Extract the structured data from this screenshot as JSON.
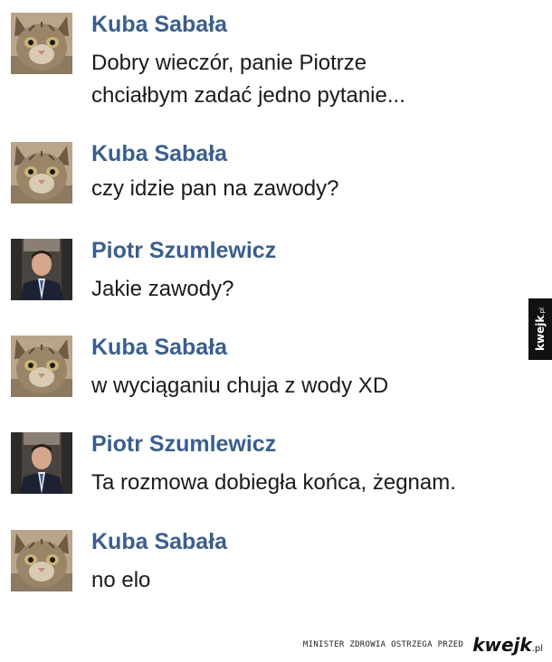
{
  "conversation": {
    "messages": [
      {
        "author": "Kuba Sabała",
        "avatar": "cat-avatar",
        "lines": [
          "Dobry wieczór, panie Piotrze",
          "chciałbym zadać jedno pytanie..."
        ]
      },
      {
        "author": "Kuba Sabała",
        "avatar": "cat-avatar",
        "lines": [
          "czy idzie pan na zawody?"
        ]
      },
      {
        "author": "Piotr Szumlewicz",
        "avatar": "man-in-suit-avatar",
        "lines": [
          "Jakie zawody?"
        ]
      },
      {
        "author": "Kuba Sabała",
        "avatar": "cat-avatar",
        "lines": [
          "w wyciąganiu chuja z wody XD"
        ]
      },
      {
        "author": "Piotr Szumlewicz",
        "avatar": "man-in-suit-avatar",
        "lines": [
          "Ta rozmowa dobiegła końca, żegnam."
        ]
      },
      {
        "author": "Kuba Sabała",
        "avatar": "cat-avatar",
        "lines": [
          "no elo"
        ]
      }
    ]
  },
  "watermark": {
    "side_text": "kwejk",
    "side_suffix": ".pl",
    "footer_warning": "Minister zdrowia ostrzega przed",
    "footer_logo": "kwejk",
    "footer_logo_suffix": ".pl"
  },
  "colors": {
    "author_name": "#3b5f8c",
    "message_text": "#1a1a1a",
    "background": "#ffffff"
  }
}
